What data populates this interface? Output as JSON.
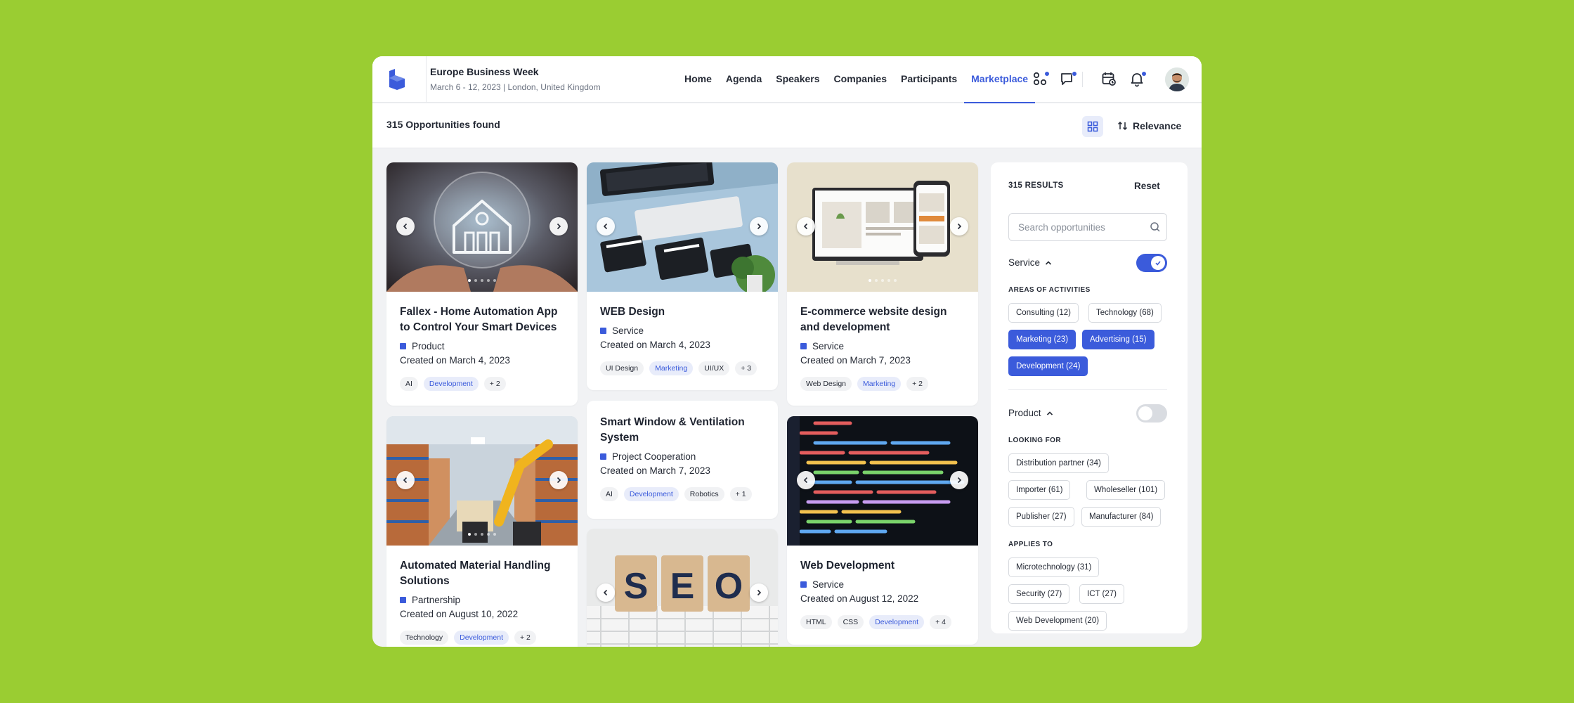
{
  "header": {
    "event_title": "Europe Business Week",
    "event_subtitle": "March 6 - 12, 2023 | London, United Kingdom",
    "nav": [
      "Home",
      "Agenda",
      "Speakers",
      "Companies",
      "Participants",
      "Marketplace"
    ],
    "active_nav": "Marketplace",
    "icons": [
      "apps-icon",
      "chat-icon",
      "calendar-clock-icon",
      "bell-icon"
    ]
  },
  "toolbar": {
    "count": "315 Opportunities found",
    "sort_label": "Relevance"
  },
  "cards": [
    {
      "title": "Fallex - Home Automation App to Control Your Smart Devices",
      "type": "Product",
      "date": "Created on March 4, 2023",
      "tags": [
        "AI",
        "Development",
        "+ 2"
      ]
    },
    {
      "title": "WEB Design",
      "type": "Service",
      "date": "Created on March 4, 2023",
      "tags": [
        "UI Design",
        "Marketing",
        "UI/UX",
        "+ 3"
      ]
    },
    {
      "title": "E-commerce website design and development",
      "type": "Service",
      "date": "Created on March 7, 2023",
      "tags": [
        "Web Design",
        "Marketing",
        "+ 2"
      ]
    },
    {
      "title": "Automated Material Handling Solutions",
      "type": "Partnership",
      "date": "Created on August 10, 2022",
      "tags": [
        "Technology",
        "Development",
        "+ 2"
      ]
    },
    {
      "title": "Smart Window & Ventilation System",
      "type": "Project Cooperation",
      "date": "Created on March 7, 2023",
      "tags": [
        "AI",
        "Development",
        "Robotics",
        "+ 1"
      ]
    },
    {
      "title": "Web Development",
      "type": "Service",
      "date": "Created on August 12, 2022",
      "tags": [
        "HTML",
        "CSS",
        "Development",
        "+ 4"
      ]
    }
  ],
  "seo_card": {
    "image_text": "SEO"
  },
  "filters": {
    "results": "315 RESULTS",
    "reset": "Reset",
    "search_placeholder": "Search opportunities",
    "service": {
      "title": "Service",
      "enabled": true,
      "areas_label": "AREAS OF ACTIVITIES",
      "chips": [
        "Consulting (12)",
        "Technology (68)",
        "Marketing (23)",
        "Advertising (15)",
        "Development (24)"
      ],
      "selected": [
        "Marketing (23)",
        "Advertising (15)",
        "Development (24)"
      ]
    },
    "product": {
      "title": "Product",
      "enabled": false,
      "looking_label": "LOOKING FOR",
      "looking_chips": [
        "Distribution partner (34)",
        "Importer (61)",
        "Wholeseller (101)",
        "Publisher (27)",
        "Manufacturer (84)"
      ],
      "applies_label": "APPLIES TO",
      "applies_chips": [
        "Microtechnology (31)",
        "Security (27)",
        "ICT (27)",
        "Web Development (20)"
      ]
    }
  },
  "colors": {
    "accent": "#3b5bdb",
    "background": "#9acd32"
  }
}
